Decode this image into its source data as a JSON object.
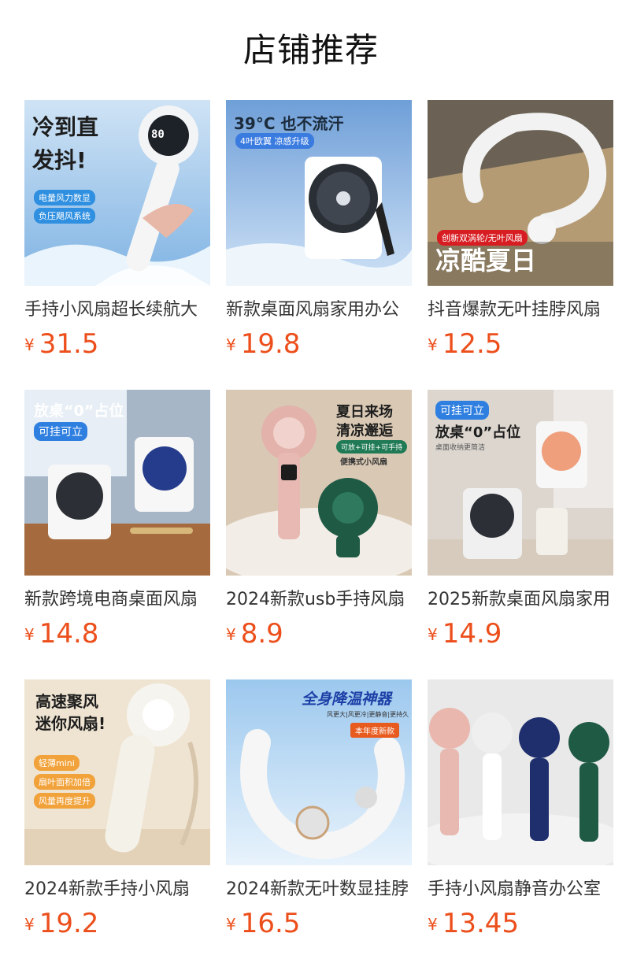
{
  "page": {
    "title": "店铺推荐"
  },
  "currency": "¥",
  "products": [
    {
      "name": "手持小风扇超长续航大",
      "price": "31.5",
      "image": {
        "headline": "冷到直",
        "headline2": "发抖!",
        "tags": [
          "电量风力数显",
          "负压飓风系统"
        ],
        "display": "80"
      }
    },
    {
      "name": "新款桌面风扇家用办公",
      "price": "19.8",
      "image": {
        "headline": "39°C 也不流汗",
        "tags": [
          "4叶欧翼 凉感升级"
        ]
      }
    },
    {
      "name": "抖音爆款无叶挂脖风扇",
      "price": "12.5",
      "image": {
        "headline": "凉酷夏日",
        "tags": [
          "创新双涡轮/无叶风扇"
        ]
      }
    },
    {
      "name": "新款跨境电商桌面风扇",
      "price": "14.8",
      "image": {
        "headline": "放桌“0”占位",
        "tags": [
          "可挂可立"
        ]
      }
    },
    {
      "name": "2024新款usb手持风扇",
      "price": "8.9",
      "image": {
        "headline": "夏日来场",
        "headline2": "清凉邂逅",
        "tags": [
          "可放+可挂+可手持",
          "便携式小风扇"
        ]
      }
    },
    {
      "name": "2025新款桌面风扇家用",
      "price": "14.9",
      "image": {
        "headline": "放桌“0”占位",
        "tags": [
          "可挂可立",
          "桌面收纳更简洁"
        ]
      }
    },
    {
      "name": "2024新款手持小风扇",
      "price": "19.2",
      "image": {
        "headline": "高速聚风",
        "headline2": "迷你风扇!",
        "tags": [
          "轻薄mini",
          "扇叶面积加倍",
          "风量再度提升"
        ]
      }
    },
    {
      "name": "2024新款无叶数显挂脖",
      "price": "16.5",
      "image": {
        "headline": "全身降温神器",
        "tags": [
          "风更大|风更冷|更静音|更持久",
          "本年度新款"
        ]
      }
    },
    {
      "name": "手持小风扇静音办公室",
      "price": "13.45",
      "image": {
        "headline": "",
        "tags": []
      }
    }
  ],
  "colors": {
    "price": "#ec4f1b",
    "title": "#111111"
  }
}
